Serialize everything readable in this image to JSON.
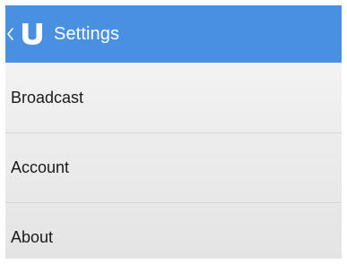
{
  "header": {
    "title": "Settings",
    "back_icon": "chevron-left-icon",
    "logo_icon": "u-logo-icon",
    "background_color": "#4a90e2",
    "text_color": "#ffffff"
  },
  "settings": {
    "items": [
      {
        "label": "Broadcast"
      },
      {
        "label": "Account"
      },
      {
        "label": "About"
      }
    ]
  }
}
